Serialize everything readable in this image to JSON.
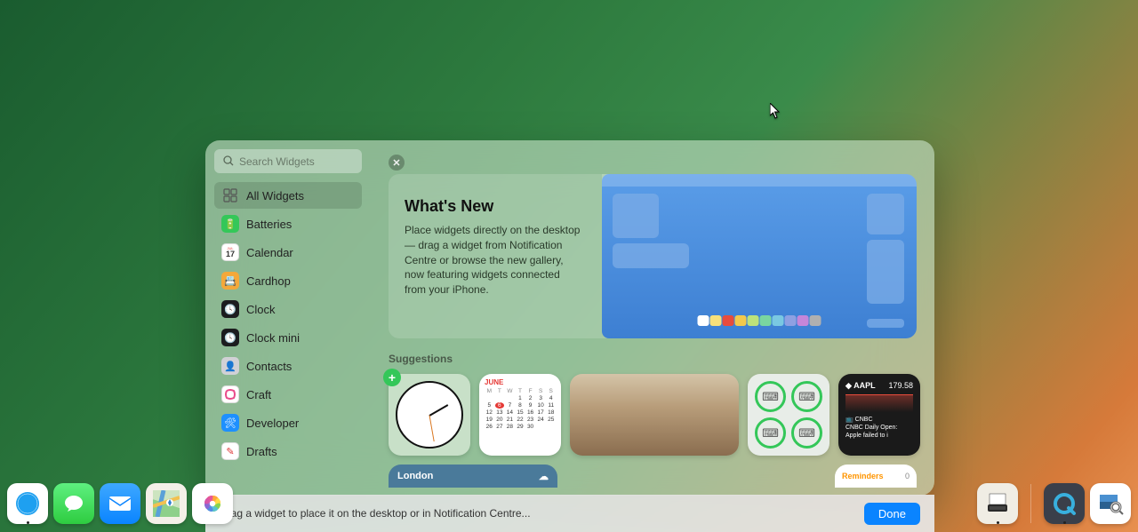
{
  "search": {
    "placeholder": "Search Widgets"
  },
  "sidebar": {
    "items": [
      {
        "label": "All Widgets",
        "icon": "grid",
        "color": "#8e8e93"
      },
      {
        "label": "Batteries",
        "icon": "battery",
        "color": "#34c759"
      },
      {
        "label": "Calendar",
        "icon": "calendar",
        "color": "#ffffff"
      },
      {
        "label": "Cardhop",
        "icon": "cardhop",
        "color": "#f4a83a"
      },
      {
        "label": "Clock",
        "icon": "clock",
        "color": "#1c1c1e"
      },
      {
        "label": "Clock mini",
        "icon": "clock",
        "color": "#1c1c1e"
      },
      {
        "label": "Contacts",
        "icon": "contacts",
        "color": "#d1d1d6"
      },
      {
        "label": "Craft",
        "icon": "craft",
        "color": "#ffffff"
      },
      {
        "label": "Developer",
        "icon": "developer",
        "color": "#1e90ff"
      },
      {
        "label": "Drafts",
        "icon": "drafts",
        "color": "#ffffff"
      }
    ],
    "selected_index": 0
  },
  "hero": {
    "title": "What's New",
    "description": "Place widgets directly on the desktop — drag a widget from Notification Centre or browse the new gallery, now featuring widgets connected from your iPhone."
  },
  "suggestions": {
    "label": "Suggestions",
    "calendar": {
      "month": "JUNE",
      "days_header": [
        "M",
        "T",
        "W",
        "T",
        "F",
        "S",
        "S"
      ],
      "today": 6
    },
    "stock": {
      "symbol": "AAPL",
      "price": "179.58",
      "source": "CNBC",
      "headline": "CNBC Daily Open: Apple failed to i"
    },
    "weather": {
      "city": "London",
      "icon": "cloud"
    },
    "reminders": {
      "label": "Reminders",
      "count": "0"
    }
  },
  "bottombar": {
    "hint": "Drag a widget to place it on the desktop or in Notification Centre...",
    "done": "Done"
  },
  "palette": [
    "#ffffff",
    "#f7e07a",
    "#e74c3c",
    "#f2c94c",
    "#bde27a",
    "#7ad6a0",
    "#7ac8e2",
    "#8ea0e2",
    "#c486d9",
    "#b0b0b0"
  ]
}
